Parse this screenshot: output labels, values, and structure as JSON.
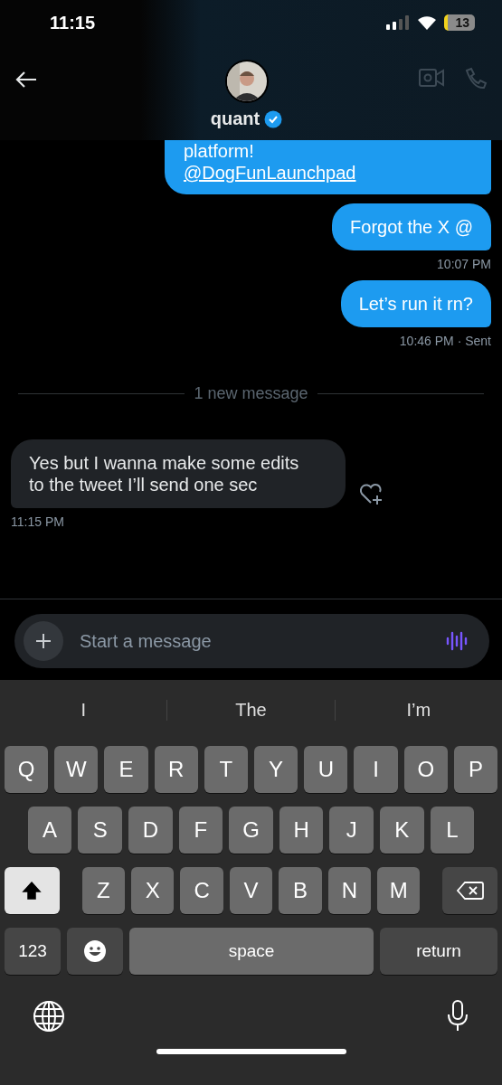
{
  "status_bar": {
    "time": "11:15",
    "battery": "13"
  },
  "header": {
    "name": "quant",
    "verified": true
  },
  "messages": [
    {
      "kind": "sent",
      "lines": [
        "platform!"
      ],
      "link": "@DogFunLaunchpad",
      "cut": true
    },
    {
      "kind": "sent",
      "lines": [
        "Forgot the X @"
      ],
      "meta": "10:07 PM"
    },
    {
      "kind": "sent",
      "lines": [
        "Let’s run it rn?"
      ],
      "meta": "10:46 PM · Sent"
    },
    {
      "kind": "divider",
      "text": "1 new message"
    },
    {
      "kind": "received",
      "lines": [
        "Yes but I wanna make some edits",
        "to the tweet I’ll send one sec"
      ],
      "meta": "11:15 PM"
    }
  ],
  "composer": {
    "placeholder": "Start a message"
  },
  "keyboard": {
    "suggestions": [
      "I",
      "The",
      "I’m"
    ],
    "letter_rows": [
      [
        {
          "label": "Q"
        },
        {
          "label": "W"
        },
        {
          "label": "E"
        },
        {
          "label": "R"
        },
        {
          "label": "T"
        },
        {
          "label": "Y"
        },
        {
          "label": "U"
        },
        {
          "label": "I"
        },
        {
          "label": "O"
        },
        {
          "label": "P"
        }
      ],
      [
        {
          "label": "A"
        },
        {
          "label": "S"
        },
        {
          "label": "D"
        },
        {
          "label": "F"
        },
        {
          "label": "G"
        },
        {
          "label": "H"
        },
        {
          "label": "J"
        },
        {
          "label": "K"
        },
        {
          "label": "L"
        }
      ],
      [
        {
          "kind": "shift",
          "on": true
        },
        {
          "label": "Z"
        },
        {
          "label": "X"
        },
        {
          "label": "C"
        },
        {
          "label": "V"
        },
        {
          "label": "B"
        },
        {
          "label": "N"
        },
        {
          "label": "M"
        },
        {
          "kind": "delete"
        }
      ]
    ],
    "bottom_keys": [
      {
        "kind": "mode",
        "label": "123"
      },
      {
        "kind": "emoji"
      },
      {
        "kind": "space",
        "label": "space"
      },
      {
        "kind": "return",
        "label": "return"
      }
    ]
  }
}
